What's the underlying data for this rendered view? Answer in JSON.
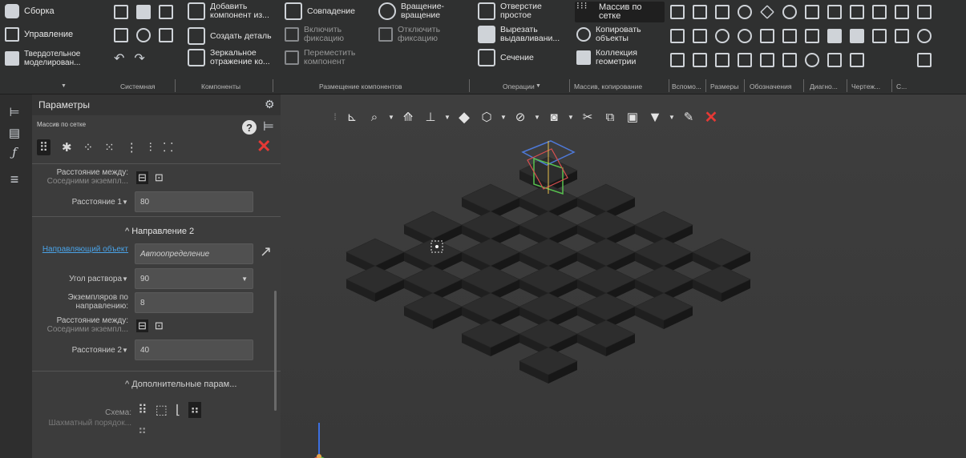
{
  "ribbon": {
    "col1": [
      "Сборка",
      "Управление",
      "Твердотельное моделирован..."
    ],
    "components": [
      "Добавить компонент из...",
      "Создать деталь",
      "Зеркальное отражение ко..."
    ],
    "placement": [
      "Совпадение",
      "Включить фиксацию",
      "Переместить компонент",
      "Вращение-вращение",
      "Отключить фиксацию"
    ],
    "operations": [
      "Отверстие простое",
      "Вырезать выдавливани...",
      "Сечение"
    ],
    "pattern": [
      "Массив по сетке",
      "Копировать объекты",
      "Коллекция геометрии"
    ],
    "groups": [
      "Системная",
      "Компоненты",
      "Размещение компонентов",
      "Операции",
      "Массив, копирование",
      "Вспомо...",
      "Размеры",
      "Обозначения",
      "Диагно...",
      "Чертеж...",
      "С..."
    ]
  },
  "panel": {
    "title": "Параметры",
    "subtitle": "Массив по сетке",
    "spacing_label": "Расстояние между:",
    "spacing_sub": "Соседними экземпл...",
    "distance1_label": "Расстояние 1",
    "distance1_value": "80",
    "direction2_header": "Направление 2",
    "direction_object_label": "Направляющий объект",
    "direction_object_value": "Автоопределение",
    "angle_label": "Угол раствора",
    "angle_value": "90",
    "count_label": "Экземпляров по направлению:",
    "count_value": "8",
    "spacing2_label": "Расстояние между:",
    "spacing2_sub": "Соседними экземпл...",
    "distance2_label": "Расстояние 2",
    "distance2_value": "40",
    "extra_header": "Дополнительные парам...",
    "scheme_label": "Схема:",
    "checker_label": "Шахматный порядок..."
  },
  "colors": {
    "accent": "#e53935",
    "link": "#4aa3e8",
    "tile": "#2d2d2d"
  },
  "viewport": {
    "tiles": 32
  }
}
